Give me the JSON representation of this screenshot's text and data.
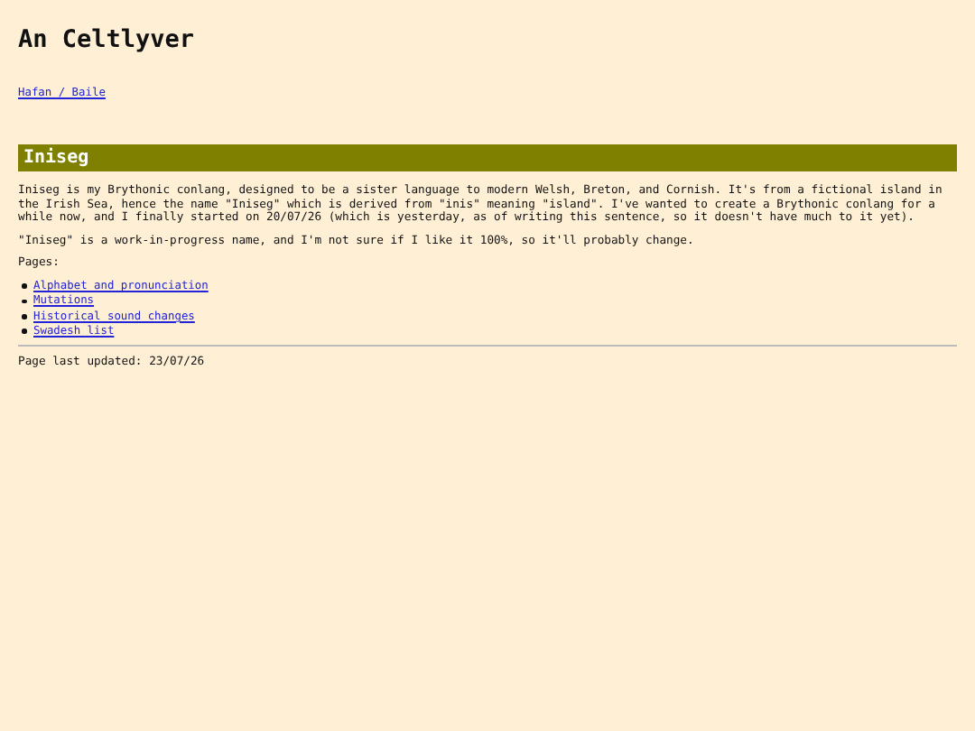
{
  "site_title": "An Celtlyver",
  "breadcrumb": "Hafan / Baile",
  "section_title": "Iniseg",
  "paragraphs": [
    "Iniseg is my Brythonic conlang, designed to be a sister language to modern Welsh, Breton, and Cornish. It's from a fictional island in the Irish Sea, hence the name \"Iniseg\" which is derived from \"inis\" meaning \"island\". I've wanted to create a Brythonic conlang for a while now, and I finally started on 20/07/26 (which is yesterday, as of writing this sentence, so it doesn't have much to it yet).",
    "\"Iniseg\" is a work-in-progress name, and I'm not sure if I like it 100%, so it'll probably change."
  ],
  "pages_label": "Pages:",
  "pages": [
    "Alphabet and pronunciation",
    "Mutations",
    "Historical sound changes",
    "Swadesh list"
  ],
  "footer": "Page last updated: 23/07/26"
}
